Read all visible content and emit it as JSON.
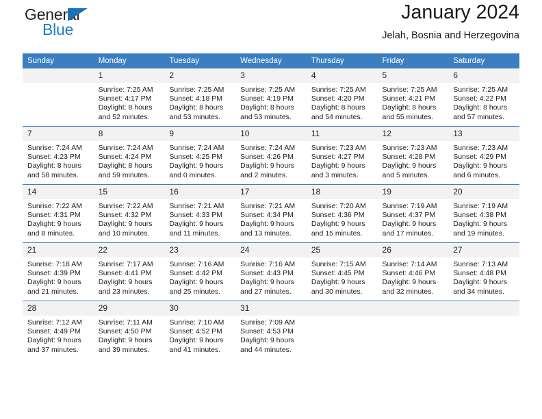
{
  "brand": {
    "name_top": "General",
    "name_bottom": "Blue",
    "accent_color": "#1b7ec6"
  },
  "header": {
    "title": "January 2024",
    "subtitle": "Jelah, Bosnia and Herzegovina"
  },
  "theme": {
    "header_bg": "#3c7fc1",
    "daynum_bg": "#f2f2f2",
    "text": "#1c1c1c"
  },
  "weekdays": [
    "Sunday",
    "Monday",
    "Tuesday",
    "Wednesday",
    "Thursday",
    "Friday",
    "Saturday"
  ],
  "weeks": [
    [
      {
        "day": "",
        "sunrise": "",
        "sunset": "",
        "daylight1": "",
        "daylight2": ""
      },
      {
        "day": "1",
        "sunrise": "Sunrise: 7:25 AM",
        "sunset": "Sunset: 4:17 PM",
        "daylight1": "Daylight: 8 hours",
        "daylight2": "and 52 minutes."
      },
      {
        "day": "2",
        "sunrise": "Sunrise: 7:25 AM",
        "sunset": "Sunset: 4:18 PM",
        "daylight1": "Daylight: 8 hours",
        "daylight2": "and 53 minutes."
      },
      {
        "day": "3",
        "sunrise": "Sunrise: 7:25 AM",
        "sunset": "Sunset: 4:19 PM",
        "daylight1": "Daylight: 8 hours",
        "daylight2": "and 53 minutes."
      },
      {
        "day": "4",
        "sunrise": "Sunrise: 7:25 AM",
        "sunset": "Sunset: 4:20 PM",
        "daylight1": "Daylight: 8 hours",
        "daylight2": "and 54 minutes."
      },
      {
        "day": "5",
        "sunrise": "Sunrise: 7:25 AM",
        "sunset": "Sunset: 4:21 PM",
        "daylight1": "Daylight: 8 hours",
        "daylight2": "and 55 minutes."
      },
      {
        "day": "6",
        "sunrise": "Sunrise: 7:25 AM",
        "sunset": "Sunset: 4:22 PM",
        "daylight1": "Daylight: 8 hours",
        "daylight2": "and 57 minutes."
      }
    ],
    [
      {
        "day": "7",
        "sunrise": "Sunrise: 7:24 AM",
        "sunset": "Sunset: 4:23 PM",
        "daylight1": "Daylight: 8 hours",
        "daylight2": "and 58 minutes."
      },
      {
        "day": "8",
        "sunrise": "Sunrise: 7:24 AM",
        "sunset": "Sunset: 4:24 PM",
        "daylight1": "Daylight: 8 hours",
        "daylight2": "and 59 minutes."
      },
      {
        "day": "9",
        "sunrise": "Sunrise: 7:24 AM",
        "sunset": "Sunset: 4:25 PM",
        "daylight1": "Daylight: 9 hours",
        "daylight2": "and 0 minutes."
      },
      {
        "day": "10",
        "sunrise": "Sunrise: 7:24 AM",
        "sunset": "Sunset: 4:26 PM",
        "daylight1": "Daylight: 9 hours",
        "daylight2": "and 2 minutes."
      },
      {
        "day": "11",
        "sunrise": "Sunrise: 7:23 AM",
        "sunset": "Sunset: 4:27 PM",
        "daylight1": "Daylight: 9 hours",
        "daylight2": "and 3 minutes."
      },
      {
        "day": "12",
        "sunrise": "Sunrise: 7:23 AM",
        "sunset": "Sunset: 4:28 PM",
        "daylight1": "Daylight: 9 hours",
        "daylight2": "and 5 minutes."
      },
      {
        "day": "13",
        "sunrise": "Sunrise: 7:23 AM",
        "sunset": "Sunset: 4:29 PM",
        "daylight1": "Daylight: 9 hours",
        "daylight2": "and 6 minutes."
      }
    ],
    [
      {
        "day": "14",
        "sunrise": "Sunrise: 7:22 AM",
        "sunset": "Sunset: 4:31 PM",
        "daylight1": "Daylight: 9 hours",
        "daylight2": "and 8 minutes."
      },
      {
        "day": "15",
        "sunrise": "Sunrise: 7:22 AM",
        "sunset": "Sunset: 4:32 PM",
        "daylight1": "Daylight: 9 hours",
        "daylight2": "and 10 minutes."
      },
      {
        "day": "16",
        "sunrise": "Sunrise: 7:21 AM",
        "sunset": "Sunset: 4:33 PM",
        "daylight1": "Daylight: 9 hours",
        "daylight2": "and 11 minutes."
      },
      {
        "day": "17",
        "sunrise": "Sunrise: 7:21 AM",
        "sunset": "Sunset: 4:34 PM",
        "daylight1": "Daylight: 9 hours",
        "daylight2": "and 13 minutes."
      },
      {
        "day": "18",
        "sunrise": "Sunrise: 7:20 AM",
        "sunset": "Sunset: 4:36 PM",
        "daylight1": "Daylight: 9 hours",
        "daylight2": "and 15 minutes."
      },
      {
        "day": "19",
        "sunrise": "Sunrise: 7:19 AM",
        "sunset": "Sunset: 4:37 PM",
        "daylight1": "Daylight: 9 hours",
        "daylight2": "and 17 minutes."
      },
      {
        "day": "20",
        "sunrise": "Sunrise: 7:19 AM",
        "sunset": "Sunset: 4:38 PM",
        "daylight1": "Daylight: 9 hours",
        "daylight2": "and 19 minutes."
      }
    ],
    [
      {
        "day": "21",
        "sunrise": "Sunrise: 7:18 AM",
        "sunset": "Sunset: 4:39 PM",
        "daylight1": "Daylight: 9 hours",
        "daylight2": "and 21 minutes."
      },
      {
        "day": "22",
        "sunrise": "Sunrise: 7:17 AM",
        "sunset": "Sunset: 4:41 PM",
        "daylight1": "Daylight: 9 hours",
        "daylight2": "and 23 minutes."
      },
      {
        "day": "23",
        "sunrise": "Sunrise: 7:16 AM",
        "sunset": "Sunset: 4:42 PM",
        "daylight1": "Daylight: 9 hours",
        "daylight2": "and 25 minutes."
      },
      {
        "day": "24",
        "sunrise": "Sunrise: 7:16 AM",
        "sunset": "Sunset: 4:43 PM",
        "daylight1": "Daylight: 9 hours",
        "daylight2": "and 27 minutes."
      },
      {
        "day": "25",
        "sunrise": "Sunrise: 7:15 AM",
        "sunset": "Sunset: 4:45 PM",
        "daylight1": "Daylight: 9 hours",
        "daylight2": "and 30 minutes."
      },
      {
        "day": "26",
        "sunrise": "Sunrise: 7:14 AM",
        "sunset": "Sunset: 4:46 PM",
        "daylight1": "Daylight: 9 hours",
        "daylight2": "and 32 minutes."
      },
      {
        "day": "27",
        "sunrise": "Sunrise: 7:13 AM",
        "sunset": "Sunset: 4:48 PM",
        "daylight1": "Daylight: 9 hours",
        "daylight2": "and 34 minutes."
      }
    ],
    [
      {
        "day": "28",
        "sunrise": "Sunrise: 7:12 AM",
        "sunset": "Sunset: 4:49 PM",
        "daylight1": "Daylight: 9 hours",
        "daylight2": "and 37 minutes."
      },
      {
        "day": "29",
        "sunrise": "Sunrise: 7:11 AM",
        "sunset": "Sunset: 4:50 PM",
        "daylight1": "Daylight: 9 hours",
        "daylight2": "and 39 minutes."
      },
      {
        "day": "30",
        "sunrise": "Sunrise: 7:10 AM",
        "sunset": "Sunset: 4:52 PM",
        "daylight1": "Daylight: 9 hours",
        "daylight2": "and 41 minutes."
      },
      {
        "day": "31",
        "sunrise": "Sunrise: 7:09 AM",
        "sunset": "Sunset: 4:53 PM",
        "daylight1": "Daylight: 9 hours",
        "daylight2": "and 44 minutes."
      },
      {
        "day": "",
        "sunrise": "",
        "sunset": "",
        "daylight1": "",
        "daylight2": ""
      },
      {
        "day": "",
        "sunrise": "",
        "sunset": "",
        "daylight1": "",
        "daylight2": ""
      },
      {
        "day": "",
        "sunrise": "",
        "sunset": "",
        "daylight1": "",
        "daylight2": ""
      }
    ]
  ]
}
